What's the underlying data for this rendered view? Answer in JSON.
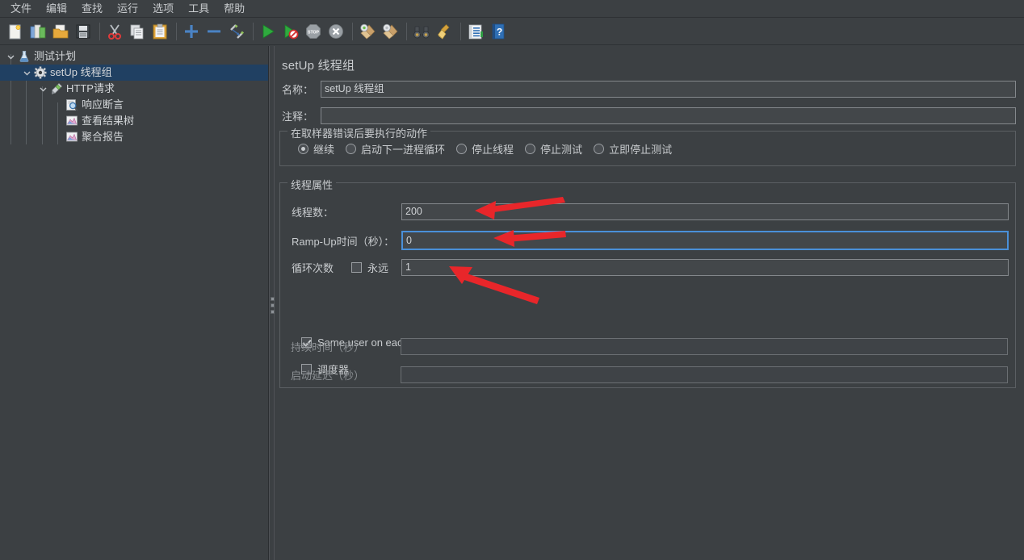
{
  "menu": {
    "items": [
      {
        "label": "文件",
        "name": "menu-file"
      },
      {
        "label": "编辑",
        "name": "menu-edit"
      },
      {
        "label": "查找",
        "name": "menu-search"
      },
      {
        "label": "运行",
        "name": "menu-run"
      },
      {
        "label": "选项",
        "name": "menu-options"
      },
      {
        "label": "工具",
        "name": "menu-tools"
      },
      {
        "label": "帮助",
        "name": "menu-help"
      }
    ]
  },
  "toolbar": {
    "buttons": [
      {
        "icon": "new-document-icon",
        "title": "新建"
      },
      {
        "icon": "templates-icon",
        "title": "模板"
      },
      {
        "icon": "open-folder-icon",
        "title": "打开"
      },
      {
        "icon": "save-floppy-icon",
        "title": "保存"
      },
      {
        "sep": true
      },
      {
        "icon": "cut-scissors-icon",
        "title": "剪切"
      },
      {
        "icon": "copy-icon",
        "title": "复制"
      },
      {
        "icon": "paste-clipboard-icon",
        "title": "粘贴"
      },
      {
        "sep": true
      },
      {
        "icon": "plus-expand-icon",
        "title": "展开"
      },
      {
        "icon": "minus-collapse-icon",
        "title": "折叠"
      },
      {
        "icon": "toggle-pencil-icon",
        "title": "切换"
      },
      {
        "sep": true
      },
      {
        "icon": "start-play-icon",
        "title": "启动"
      },
      {
        "icon": "start-no-pauses-icon",
        "title": "无间隔启动"
      },
      {
        "icon": "stop-sign-icon",
        "title": "停止"
      },
      {
        "icon": "shutdown-icon",
        "title": "关闭"
      },
      {
        "sep": true
      },
      {
        "icon": "clear-broom-icon",
        "title": "清除"
      },
      {
        "icon": "clear-all-broom-icon",
        "title": "清除全部"
      },
      {
        "sep": true
      },
      {
        "icon": "search-binoculars-icon",
        "title": "查找"
      },
      {
        "icon": "reset-broom-icon",
        "title": "重置查找"
      },
      {
        "sep": true
      },
      {
        "icon": "function-helper-icon",
        "title": "函数助手"
      },
      {
        "icon": "help-book-icon",
        "title": "帮助"
      }
    ]
  },
  "tree": {
    "nodes": [
      {
        "label": "测试计划",
        "icon": "test-plan-flask-icon",
        "depth": 0,
        "twisty": "down",
        "selected": false,
        "name": "tree-node-test-plan"
      },
      {
        "label": "setUp 线程组",
        "icon": "gear-icon",
        "depth": 1,
        "twisty": "down",
        "selected": true,
        "name": "tree-node-setup-thread-group"
      },
      {
        "label": "HTTP请求",
        "icon": "http-request-pen-icon",
        "depth": 2,
        "twisty": "down",
        "selected": false,
        "name": "tree-node-http-request"
      },
      {
        "label": "响应断言",
        "icon": "assertion-magnifier-icon",
        "depth": 3,
        "twisty": "none",
        "selected": false,
        "name": "tree-node-response-assertion"
      },
      {
        "label": "查看结果树",
        "icon": "results-tree-chart-icon",
        "depth": 3,
        "twisty": "none",
        "selected": false,
        "name": "tree-node-view-results-tree"
      },
      {
        "label": "聚合报告",
        "icon": "aggregate-report-chart-icon",
        "depth": 3,
        "twisty": "none",
        "selected": false,
        "name": "tree-node-aggregate-report"
      }
    ]
  },
  "panel": {
    "title": "setUp 线程组",
    "name_label": "名称：",
    "name_value": "setUp 线程组",
    "comment_label": "注释：",
    "comment_value": "",
    "error_action": {
      "group_title": "在取样器错误后要执行的动作",
      "options": [
        {
          "label": "继续",
          "selected": true,
          "name": "radio-continue"
        },
        {
          "label": "启动下一进程循环",
          "selected": false,
          "name": "radio-start-next-loop"
        },
        {
          "label": "停止线程",
          "selected": false,
          "name": "radio-stop-thread"
        },
        {
          "label": "停止测试",
          "selected": false,
          "name": "radio-stop-test"
        },
        {
          "label": "立即停止测试",
          "selected": false,
          "name": "radio-stop-test-now"
        }
      ]
    },
    "thread_props": {
      "group_title": "线程属性",
      "threads_label": "线程数：",
      "threads_value": "200",
      "rampup_label": "Ramp-Up时间（秒）：",
      "rampup_value": "0",
      "loops_label": "循环次数",
      "forever_label": "永远",
      "forever_checked": false,
      "loops_value": "1",
      "same_user_label": "Same user on each iteration",
      "same_user_checked": true,
      "scheduler_label": "调度器",
      "scheduler_checked": false,
      "duration_label": "持续时间（秒）",
      "duration_value": "",
      "startup_delay_label": "启动延迟（秒）",
      "startup_delay_value": ""
    }
  },
  "annotations": {
    "arrow_color": "#e8262a",
    "arrows": [
      {
        "name": "arrow-threads-count",
        "target": "线程数"
      },
      {
        "name": "arrow-rampup-time",
        "target": "Ramp-Up时间"
      },
      {
        "name": "arrow-loop-count",
        "target": "循环次数"
      }
    ]
  },
  "colors": {
    "background": "#3c4043",
    "selection": "#204062",
    "field_background": "#43474a",
    "focus_border": "#4a90d9",
    "text": "#c9cccf"
  }
}
